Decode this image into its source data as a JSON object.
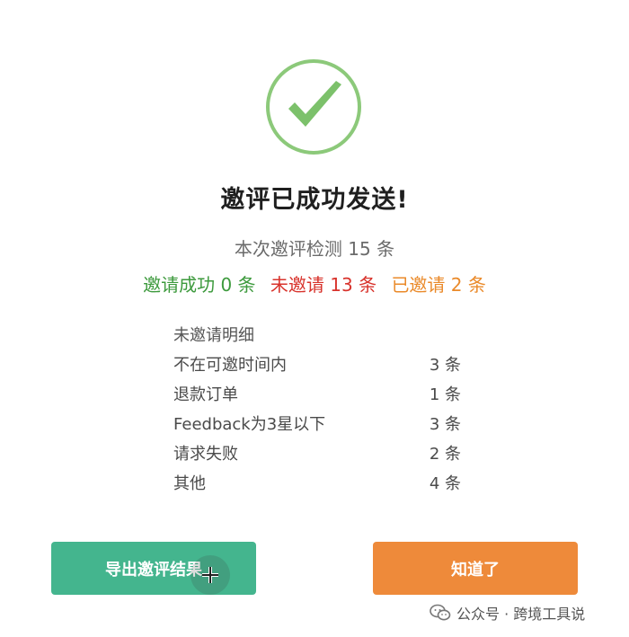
{
  "dialog": {
    "title": "邀评已成功发送!",
    "summary": "本次邀评检测 15 条",
    "stats": {
      "success": {
        "label": "邀请成功 0 条",
        "color": "#3d9a3d"
      },
      "not_invited": {
        "label": "未邀请 13 条",
        "color": "#d8332c"
      },
      "already_invited": {
        "label": "已邀请 2 条",
        "color": "#ea8a2a"
      }
    },
    "detail": {
      "heading": "未邀请明细",
      "rows": [
        {
          "label": "不在可邀时间内",
          "count": "3 条"
        },
        {
          "label": "退款订单",
          "count": "1 条"
        },
        {
          "label": "Feedback为3星以下",
          "count": "3 条"
        },
        {
          "label": "请求失败",
          "count": "2 条"
        },
        {
          "label": "其他",
          "count": "4 条"
        }
      ]
    },
    "buttons": {
      "export_label": "导出邀评结果",
      "ok_label": "知道了"
    },
    "icon": "check-circle-icon",
    "colors": {
      "success_green": "#7cc16b",
      "export_button": "#44b58e",
      "ok_button": "#ee8a3a"
    }
  },
  "watermark": {
    "text": "公众号 · 跨境工具说",
    "icon": "wechat-icon"
  }
}
